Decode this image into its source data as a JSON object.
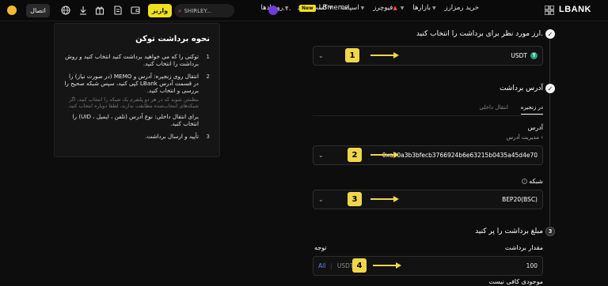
{
  "nav": {
    "logo": "LBANK",
    "items": [
      {
        "label": "خرید رمزارز"
      },
      {
        "label": "بازارها"
      },
      {
        "label": "فیوچرز"
      },
      {
        "label": "اسپات"
      },
      {
        "label": "کسب سود"
      },
      {
        "label": "رویدادها"
      }
    ],
    "new_badge": "New",
    "lbmeme": "LBmeme",
    "more": "...",
    "search_value": "SHIRLEY...",
    "deposit_label": "واریز",
    "connect_label": "اتصال"
  },
  "guide": {
    "title": "نحوه برداشت توکن",
    "step1_num": "1",
    "step1_text": "توکنی را که می خواهید برداشت کنید انتخاب کنید و روش برداشت را انتخاب کنید.",
    "step2_num": "2",
    "step2_text": "انتقال روی زنجیره: آدرس و MEMO (در صورت نیاز) را در قسمت آدرس LBank کپی کنید، سپس شبکه صحیح را بررسی و انتخاب کنید.",
    "step2_note": "مطمئن شوید که در هر دو پلتفرم یک شبکه را انتخاب کنید، اگر شبکه‌های انتخاب‌شده مطابقت ندارند، لطفا دوباره انتخاب کنید.",
    "step2_sub": "برای انتقال داخلی: نوع آدرس (تلفن ، ایمیل ، UID) را انتخاب کنید.",
    "step3_num": "3",
    "step3_text": "تأیید و ارسال برداشت."
  },
  "form": {
    "s1_title": "ارز مورد نظر برای برداشت را انتخاب کنید.",
    "token_value": "USDT",
    "token_icon": "T",
    "s2_title": "آدرس برداشت",
    "tab_onchain": "در زنجیره",
    "tab_internal": "انتقال داخلی",
    "address_label": "آدرس",
    "address_manage": "مدیریت آدرس",
    "address_value": "0xa90a3b3bfecb3766924b6e63215b0435a45d4e70",
    "network_label": "شبکه",
    "network_value": "BEP20(BSC)",
    "s3_num": "3",
    "s3_title": "مبلغ برداشت را پر کنید",
    "amount_label": "مقدار برداشت",
    "notice_label": "توجه",
    "amount_value": "100",
    "amount_currency": "USDT",
    "amount_all": "All",
    "balance_warning": "موجودی کافی نیست"
  },
  "annotations": {
    "b1": "1",
    "b2": "2",
    "b3": "3",
    "b4": "4",
    "color": "#f0d64a"
  }
}
